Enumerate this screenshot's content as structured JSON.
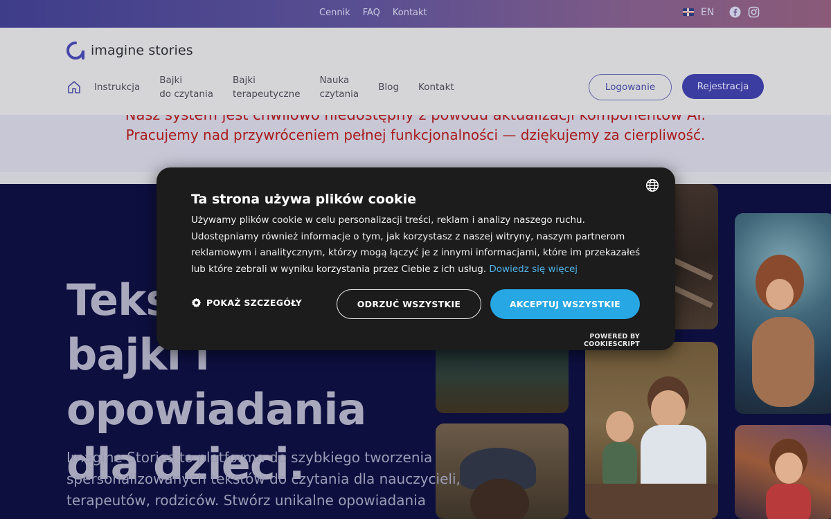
{
  "topbar": {
    "links": [
      "Cennik",
      "FAQ",
      "Kontakt"
    ],
    "language": "EN"
  },
  "header": {
    "logo_text": "imagine stories",
    "nav": [
      {
        "line1": "Instrukcja",
        "line2": ""
      },
      {
        "line1": "Bajki",
        "line2": "do czytania"
      },
      {
        "line1": "Bajki",
        "line2": "terapeutyczne"
      },
      {
        "line1": "Nauka",
        "line2": "czytania"
      },
      {
        "line1": "Blog",
        "line2": ""
      },
      {
        "line1": "Kontakt",
        "line2": ""
      }
    ],
    "login": "Logowanie",
    "register": "Rejestracja"
  },
  "notice": {
    "line1": "Nasz system jest chwilowo niedostępny z powodu aktualizacji komponentów AI.",
    "line2": "Pracujemy nad przywróceniem pełnej funkcjonalności — dziękujemy za cierpliwość."
  },
  "hero": {
    "title_l1": "Teksty,",
    "title_l2": "bajki i opowiadania",
    "title_l3": "dla dzieci.",
    "text": "Imagine Stories to platforma do szybkiego tworzenia spersonalizowanych tekstów do czytania dla nauczycieli, terapeutów, rodziców. Stwórz unikalne opowiadania"
  },
  "cookie": {
    "title": "Ta strona używa plików cookie",
    "body": "Używamy plików cookie w celu personalizacji treści, reklam i analizy naszego ruchu. Udostępniamy również informacje o tym, jak korzystasz z naszej witryny, naszym partnerom reklamowym i analitycznym, którzy mogą łączyć je z innymi informacjami, które im przekazałeś lub które zebrali w wyniku korzystania przez Ciebie z ich usług.",
    "learn_more": "Dowiedz się więcej",
    "details": "POKAŻ SZCZEGÓŁY",
    "reject": "ODRZUĆ WSZYSTKIE",
    "accept": "AKCEPTUJ WSZYSTKIE",
    "powered": "POWERED BY COOKIESCRIPT"
  },
  "icons": {
    "globe": "globe-icon",
    "gear": "gear-icon",
    "home": "home-icon",
    "facebook": "facebook-icon",
    "instagram": "instagram-icon",
    "flag": "uk-flag-icon"
  },
  "colors": {
    "accent": "#27a7e4",
    "brand": "#3c3da0",
    "notice": "#a81c1c"
  }
}
